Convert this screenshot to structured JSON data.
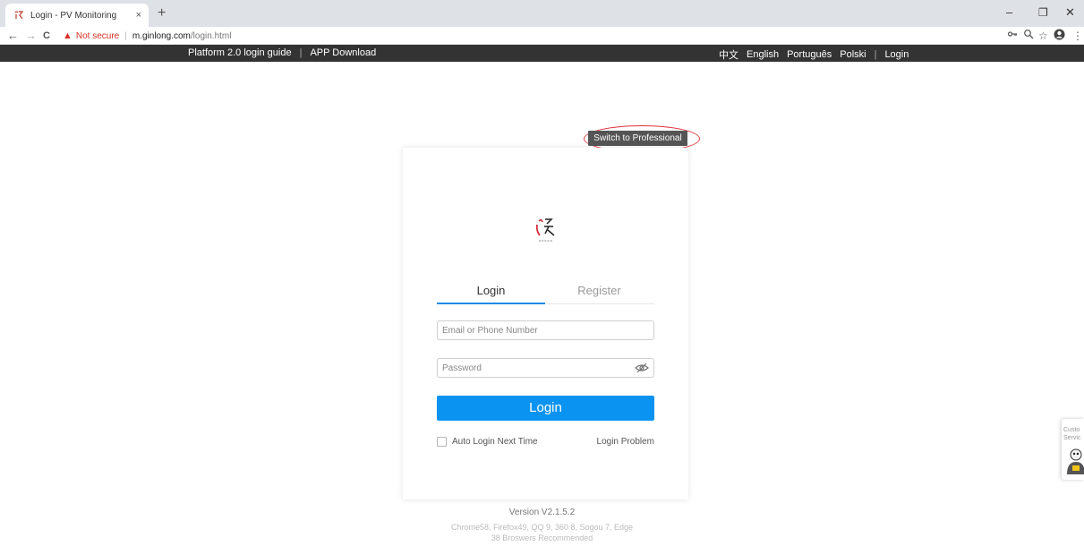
{
  "browser": {
    "tab_title": "Login - PV Monitoring",
    "tab_close": "×",
    "new_tab": "+",
    "not_secure": "Not secure",
    "url_host": "m.ginlong.com",
    "url_path": "/login.html",
    "back": "←",
    "forward": "→",
    "reload": "C",
    "minimize": "–",
    "restore": "❐",
    "close": "✕"
  },
  "sitenav": {
    "guide": "Platform 2.0 login guide",
    "app": "APP Download",
    "languages": [
      "中文",
      "English",
      "Português",
      "Polski"
    ],
    "login": "Login"
  },
  "switch_label": "Switch to Professional",
  "card": {
    "tab_login": "Login",
    "tab_register": "Register",
    "email_placeholder": "Email or Phone Number",
    "password_placeholder": "Password",
    "login_button": "Login",
    "auto_login": "Auto Login Next Time",
    "login_problem": "Login Problem"
  },
  "footer": {
    "version": "Version V2.1.5.2",
    "browsers_line1": "Chrome58, Firefox49, QQ 9, 360 8, Sogou 7, Edge",
    "browsers_line2": "38 Broswers Recommended"
  },
  "customer_service": "Custo Servic",
  "colors": {
    "primary": "#0a93f0",
    "tab_underline": "#1f8ce6",
    "nav_bg": "#333333",
    "annotation_red": "#e0343e"
  }
}
